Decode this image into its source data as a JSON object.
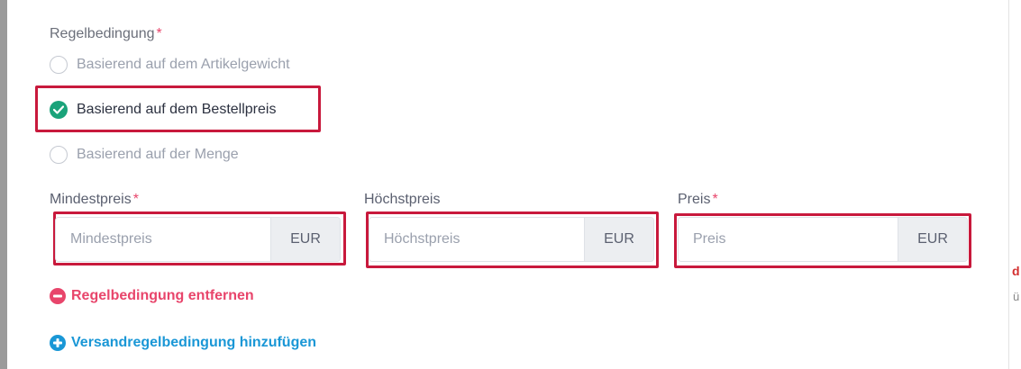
{
  "rule_condition": {
    "label": "Regelbedingung",
    "required_mark": "*",
    "options": [
      {
        "label": "Basierend auf dem Artikelgewicht",
        "checked": false
      },
      {
        "label": "Basierend auf dem Bestellpreis",
        "checked": true
      },
      {
        "label": "Basierend auf der Menge",
        "checked": false
      }
    ]
  },
  "fields": {
    "min_price": {
      "label": "Mindestpreis",
      "required_mark": "*",
      "placeholder": "Mindestpreis",
      "value": "",
      "currency": "EUR"
    },
    "max_price": {
      "label": "Höchstpreis",
      "placeholder": "Höchstpreis",
      "value": "",
      "currency": "EUR"
    },
    "price": {
      "label": "Preis",
      "required_mark": "*",
      "placeholder": "Preis",
      "value": "",
      "currency": "EUR"
    }
  },
  "actions": {
    "remove_condition": "Regelbedingung entfernen",
    "add_condition": "Versandregelbedingung hinzufügen"
  },
  "colors": {
    "accent_green": "#1aa37a",
    "required_red": "#e8456b",
    "link_blue": "#1a97d6",
    "highlight_red": "#c8193c"
  }
}
